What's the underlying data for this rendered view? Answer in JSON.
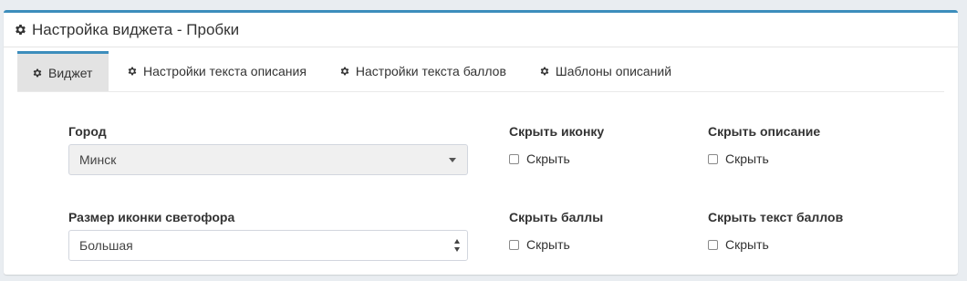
{
  "panel": {
    "title": "Настройка виджета - Пробки",
    "accent_color": "#3c8dbc"
  },
  "tabs": [
    {
      "label": "Виджет",
      "icon": "gear-icon",
      "active": true
    },
    {
      "label": "Настройки текста описания",
      "icon": "gear-icon",
      "active": false
    },
    {
      "label": "Настройки текста баллов",
      "icon": "gear-icon",
      "active": false
    },
    {
      "label": "Шаблоны описаний",
      "icon": "gear-icon",
      "active": false
    }
  ],
  "form": {
    "city": {
      "label": "Город",
      "value": "Минск"
    },
    "icon_size": {
      "label": "Размер иконки светофора",
      "value": "Большая"
    },
    "hide_icon": {
      "label": "Скрыть иконку",
      "checkbox_label": "Скрыть",
      "checked": false
    },
    "hide_description": {
      "label": "Скрыть описание",
      "checkbox_label": "Скрыть",
      "checked": false
    },
    "hide_points": {
      "label": "Скрыть баллы",
      "checkbox_label": "Скрыть",
      "checked": false
    },
    "hide_points_text": {
      "label": "Скрыть текст баллов",
      "checkbox_label": "Скрыть",
      "checked": false
    }
  }
}
